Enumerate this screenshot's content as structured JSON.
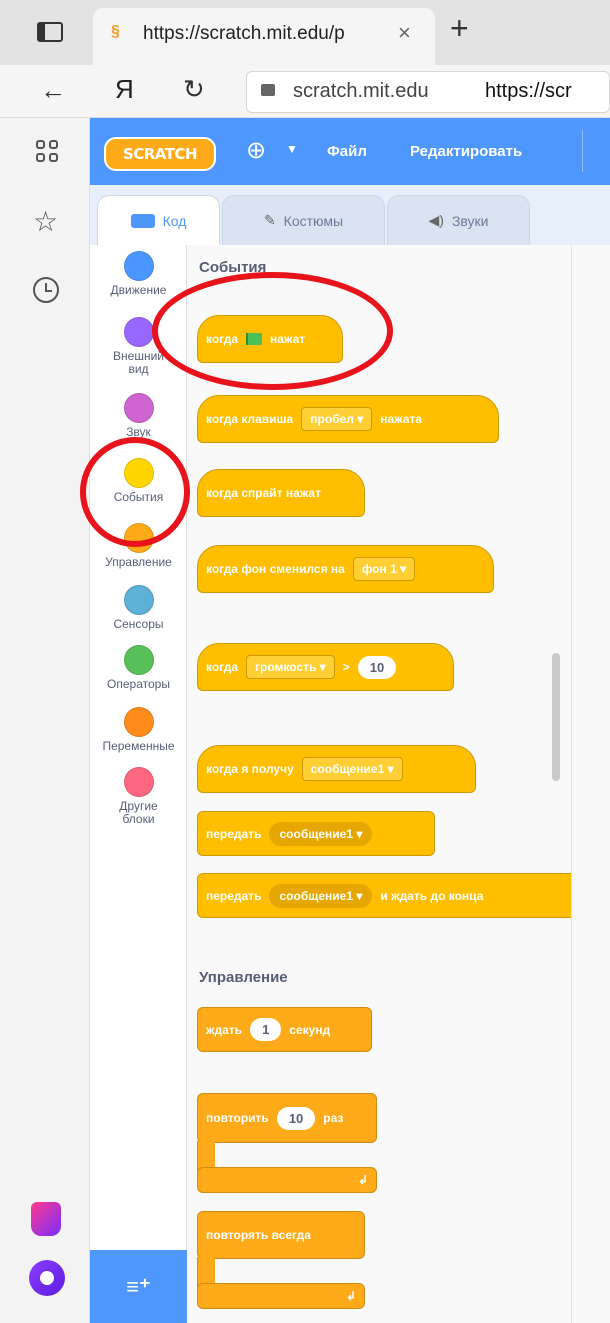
{
  "browser": {
    "tab_title": "https://scratch.mit.edu/p",
    "tab_close": "×",
    "new_tab": "+",
    "back": "←",
    "yandex_btn": "Я",
    "reload": "↻",
    "url_host": "scratch.mit.edu",
    "url_rest": "https://scr"
  },
  "scratch": {
    "logo": "SCRATCH",
    "menu": {
      "file": "Файл",
      "edit": "Редактировать"
    },
    "tabs": [
      {
        "label": "Код"
      },
      {
        "label": "Костюмы"
      },
      {
        "label": "Звуки"
      }
    ],
    "categories": [
      {
        "label": "Движение",
        "color": "#4c97ff"
      },
      {
        "label": "Внешний вид",
        "color": "#9966ff"
      },
      {
        "label": "Звук",
        "color": "#cf63cf"
      },
      {
        "label": "События",
        "color": "#ffd500"
      },
      {
        "label": "Управление",
        "color": "#ffab19"
      },
      {
        "label": "Сенсоры",
        "color": "#5cb1d6"
      },
      {
        "label": "Операторы",
        "color": "#59c059"
      },
      {
        "label": "Переменные",
        "color": "#ff8c1a"
      },
      {
        "label": "Другие блоки",
        "color": "#ff6680"
      }
    ],
    "section_events": "События",
    "section_control": "Управление",
    "blocks": {
      "flag": {
        "pre": "когда",
        "post": "нажат"
      },
      "key": {
        "pre": "когда клавиша",
        "dd": "пробел",
        "post": "нажата"
      },
      "sprite": "когда спрайт нажат",
      "backdrop": {
        "pre": "когда фон сменился на",
        "dd": "фон 1"
      },
      "volume": {
        "pre": "когда",
        "dd": "громкость",
        "op": ">",
        "num": "10"
      },
      "receive": {
        "pre": "когда я получу",
        "dd": "сообщение1"
      },
      "broadcast": {
        "pre": "передать",
        "dd": "сообщение1"
      },
      "broadcast_wait": {
        "pre": "передать",
        "dd": "сообщение1",
        "post": "и ждать до конца"
      },
      "wait": {
        "pre": "ждать",
        "num": "1",
        "post": "секунд"
      },
      "repeat": {
        "pre": "повторить",
        "num": "10",
        "post": "раз"
      },
      "forever": "повторять всегда"
    }
  },
  "colors": {
    "accent": "#4d97ff",
    "events": "#ffbf00",
    "highlight": "#e8131b"
  }
}
